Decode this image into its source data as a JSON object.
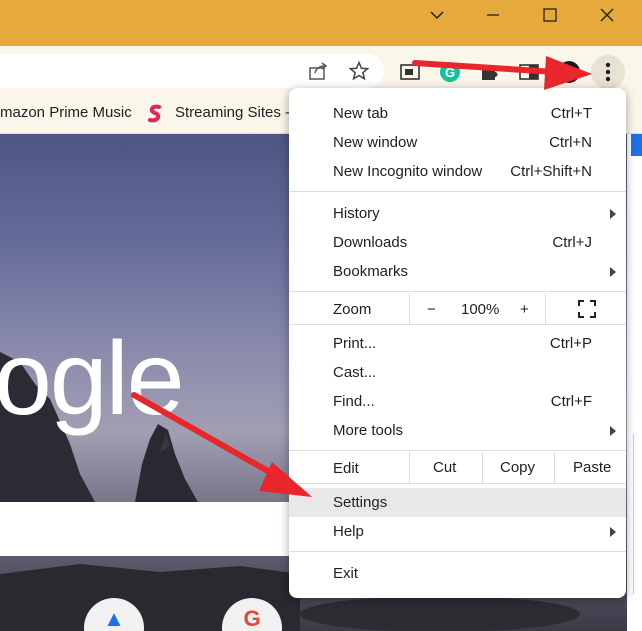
{
  "window": {
    "controls": {
      "minimize": "—",
      "maximize": "☐",
      "close": "✕"
    }
  },
  "toolbar": {
    "icons": [
      "share-icon",
      "bookmark-star-icon",
      "extension-window-icon",
      "grammarly-icon",
      "puzzle-extensions-icon",
      "profile-icon",
      "kebab-menu-icon"
    ]
  },
  "bookmarks": {
    "items": [
      {
        "label": "mazon Prime Music"
      },
      {
        "label": "Streaming Sites -"
      }
    ]
  },
  "page": {
    "logo_text": "ogle"
  },
  "menu": {
    "new_tab": {
      "label": "New tab",
      "shortcut": "Ctrl+T"
    },
    "new_window": {
      "label": "New window",
      "shortcut": "Ctrl+N"
    },
    "new_incognito": {
      "label": "New Incognito window",
      "shortcut": "Ctrl+Shift+N"
    },
    "history": {
      "label": "History"
    },
    "downloads": {
      "label": "Downloads",
      "shortcut": "Ctrl+J"
    },
    "bookmarks": {
      "label": "Bookmarks"
    },
    "zoom": {
      "label": "Zoom",
      "minus": "−",
      "value": "100%",
      "plus": "+"
    },
    "print": {
      "label": "Print...",
      "shortcut": "Ctrl+P"
    },
    "cast": {
      "label": "Cast..."
    },
    "find": {
      "label": "Find...",
      "shortcut": "Ctrl+F"
    },
    "more_tools": {
      "label": "More tools"
    },
    "edit": {
      "label": "Edit",
      "cut": "Cut",
      "copy": "Copy",
      "paste": "Paste"
    },
    "settings": {
      "label": "Settings"
    },
    "help": {
      "label": "Help"
    },
    "exit": {
      "label": "Exit"
    }
  },
  "colors": {
    "titlebar": "#e6a93b",
    "toolbar": "#fbf6ea",
    "annotation_arrow": "#e8262b",
    "highlight": "#e8e8e8"
  }
}
